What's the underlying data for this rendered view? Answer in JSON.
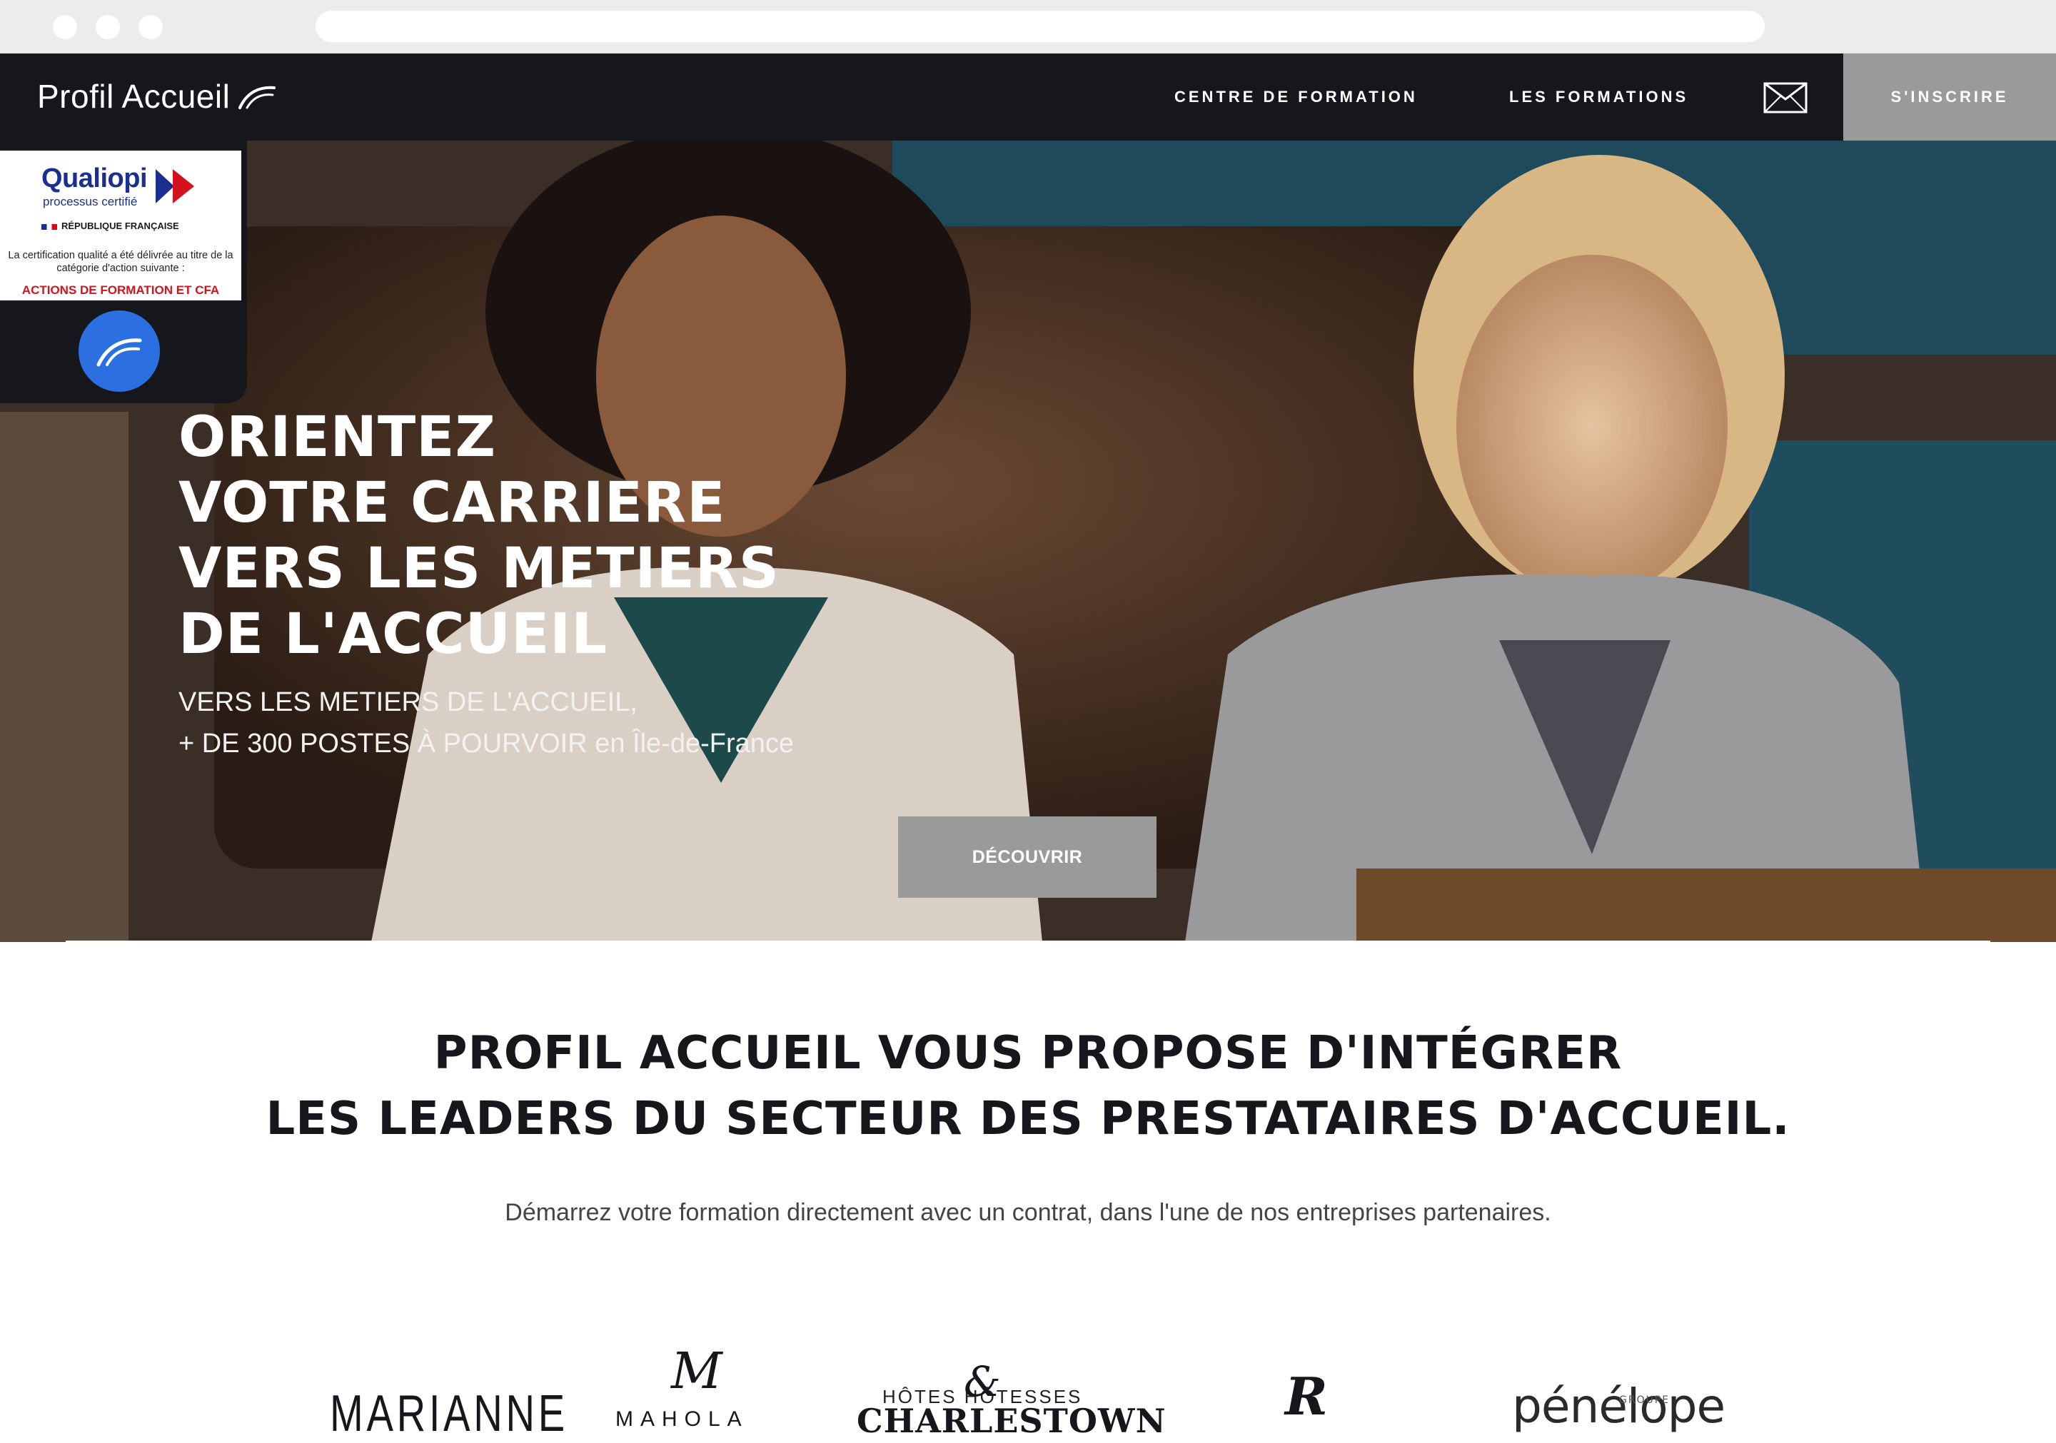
{
  "site": {
    "logo_text": "Profil Accueil"
  },
  "nav": {
    "items": [
      {
        "label": "CENTRE DE FORMATION"
      },
      {
        "label": "LES FORMATIONS"
      }
    ],
    "signup_label": "S'INSCRIRE",
    "mail_icon": "mail-icon"
  },
  "badge": {
    "qualiopi": "Qualiopi",
    "qualiopi_sub": "processus certifié",
    "republique": "RÉPUBLIQUE FRANÇAISE",
    "note": "La certification qualité a été délivrée au titre de la catégorie d'action suivante :",
    "action": "ACTIONS DE FORMATION ET CFA"
  },
  "hero": {
    "title_lines": [
      "ORIENTEZ",
      "VOTRE CARRIERE",
      "VERS LES METIERS",
      "DE L'ACCUEIL"
    ],
    "subtitle_line1": "VERS LES METIERS DE L'ACCUEIL,",
    "subtitle_line2": "+ DE 300 POSTES À POURVOIR en Île-de-France",
    "button_label": "DÉCOUVRIR"
  },
  "intro": {
    "title_line1": "PROFIL ACCUEIL VOUS PROPOSE D'INTÉGRER",
    "title_line2": "LES LEADERS DU SECTEUR DES PRESTATAIRES D'ACCUEIL.",
    "subtitle": "Démarrez votre formation directement avec un contrat, dans l'une de nos entreprises partenaires."
  },
  "partners": {
    "marianne": "MARIANNE",
    "mahola_mark": "M",
    "mahola": "MAHOLA",
    "charlestown_top": "HÔTES    HÔTESSES",
    "charlestown_amp": "&",
    "charlestown": "CHARLESTOWN",
    "rc": "R",
    "penelope": "pénélope",
    "penelope_group": "GROUPE"
  },
  "colors": {
    "nav_bg": "#16161d",
    "accent_grey": "#999b9b",
    "qualiopi_blue": "#1a2f8f",
    "qualiopi_red": "#d4121c",
    "circle_blue": "#2b6fe0"
  }
}
